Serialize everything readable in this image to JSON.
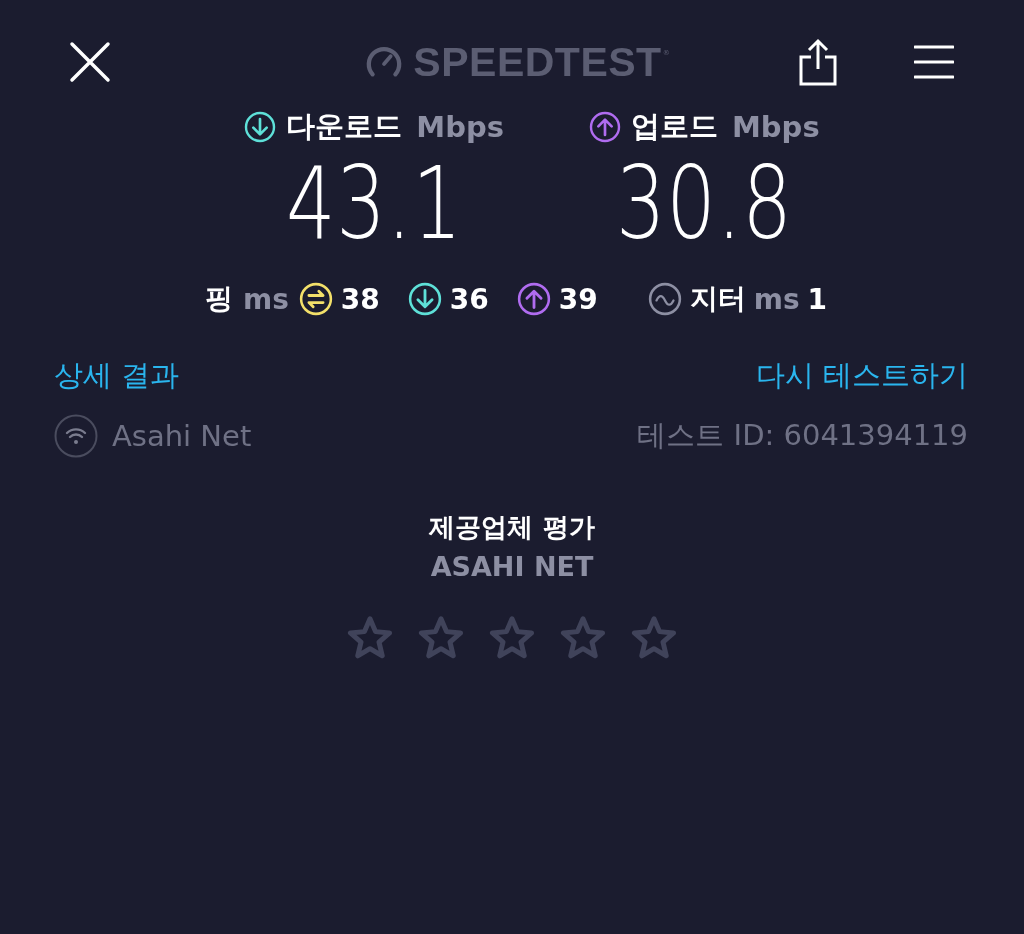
{
  "header": {
    "logo": "SPEEDTEST",
    "logo_mark": "®"
  },
  "results": [
    {
      "kind": "download",
      "label": "다운로드",
      "unit": "Mbps",
      "value": "43.1"
    },
    {
      "kind": "upload",
      "label": "업로드",
      "unit": "Mbps",
      "value": "30.8"
    }
  ],
  "ping": {
    "label": "핑",
    "unit": "ms",
    "items": [
      {
        "kind": "idle",
        "value": "38"
      },
      {
        "kind": "download",
        "value": "36"
      },
      {
        "kind": "upload",
        "value": "39"
      }
    ]
  },
  "jitter": {
    "label": "지터",
    "unit": "ms",
    "value": "1"
  },
  "links": {
    "details": "상세 결과",
    "retest": "다시 테스트하기"
  },
  "provider": {
    "name": "Asahi Net",
    "test_id": "테스트 ID: 6041394119"
  },
  "rating": {
    "title": "제공업체 평가",
    "provider": "ASAHI NET",
    "stars": 0
  }
}
